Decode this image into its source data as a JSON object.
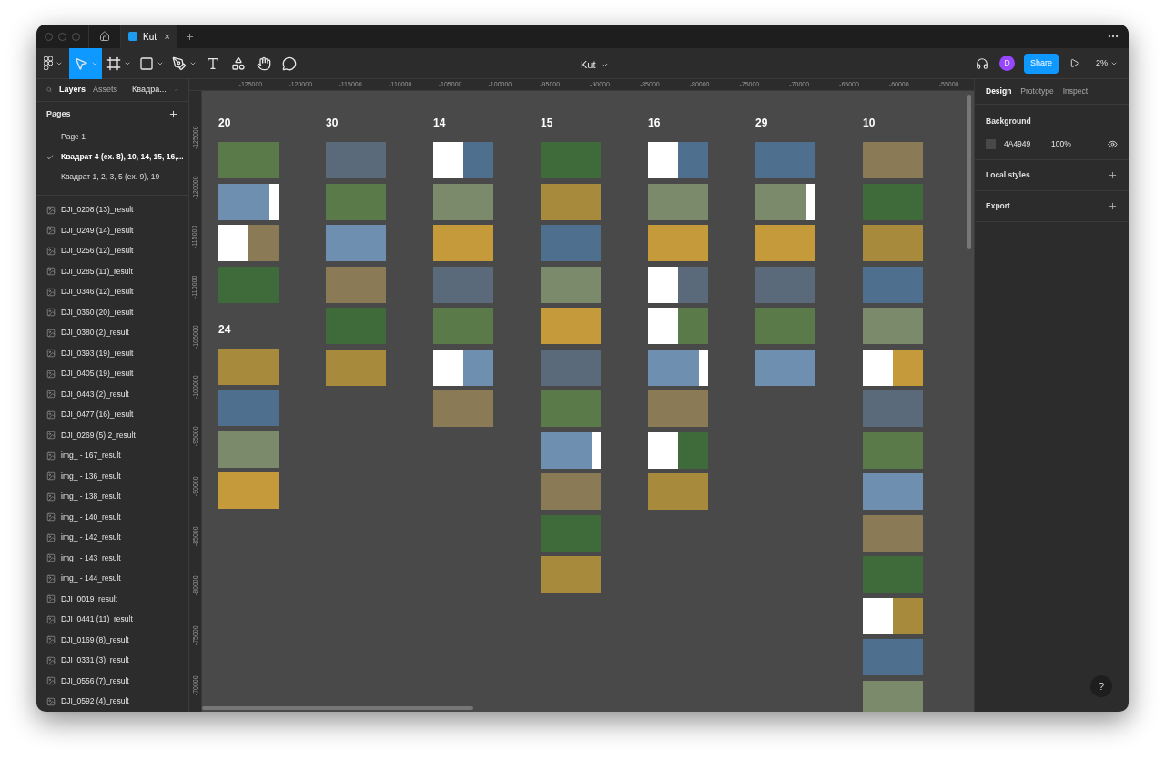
{
  "tab": {
    "title": "Kut",
    "close": "×"
  },
  "toolbar": {
    "tools": [
      {
        "kind": "main-menu",
        "selected": false
      },
      {
        "kind": "move",
        "selected": true
      },
      {
        "kind": "frame",
        "selected": false
      },
      {
        "kind": "shape",
        "selected": false
      },
      {
        "kind": "pen",
        "selected": false
      },
      {
        "kind": "text",
        "selected": false
      },
      {
        "kind": "resources",
        "selected": false
      },
      {
        "kind": "hand",
        "selected": false
      },
      {
        "kind": "comment",
        "selected": false
      }
    ],
    "file_name": "Kut",
    "avatar": "D",
    "share": "Share",
    "zoom": "2%"
  },
  "left_panel": {
    "tabs": [
      {
        "label": "Layers",
        "selected": true
      },
      {
        "label": "Assets",
        "selected": false
      }
    ],
    "page_switch": "Квадра...",
    "pages_title": "Pages",
    "pages": [
      {
        "label": "Page 1",
        "selected": false
      },
      {
        "label": "Квадрат 4 (ex. 8), 10, 14, 15, 16,...",
        "selected": true
      },
      {
        "label": "Квадрат 1, 2, 3, 5 (ex. 9), 19",
        "selected": false
      }
    ],
    "layers": [
      "DJI_0208 (13)_result",
      "DJI_0249 (14)_result",
      "DJI_0256 (12)_result",
      "DJI_0285 (11)_result",
      "DJI_0346 (12)_result",
      "DJI_0360 (20)_result",
      "DJI_0380 (2)_result",
      "DJI_0393 (19)_result",
      "DJI_0405 (19)_result",
      "DJI_0443 (2)_result",
      "DJI_0477 (16)_result",
      "DJI_0269 (5) 2_result",
      "img_ - 167_result",
      "img_ - 136_result",
      "img_ - 138_result",
      "img_ - 140_result",
      "img_ - 142_result",
      "img_ - 143_result",
      "img_ - 144_result",
      "DJI_0019_result",
      "DJI_0441 (11)_result",
      "DJI_0169 (8)_result",
      "DJI_0331 (3)_result",
      "DJI_0556 (7)_result",
      "DJI_0592 (4)_result"
    ]
  },
  "rulers": {
    "horizontal": [
      "-125000",
      "-120000",
      "-115000",
      "-110000",
      "-105000",
      "-100000",
      "-95000",
      "-90000",
      "-85000",
      "-80000",
      "-75000",
      "-70000",
      "-65000",
      "-60000",
      "-55000"
    ],
    "vertical": [
      "-125000",
      "-120000",
      "-115000",
      "-110000",
      "-105000",
      "-100000",
      "-95000",
      "-90000",
      "-85000",
      "-80000",
      "-75000",
      "-70000"
    ]
  },
  "canvas": {
    "columns": [
      [
        {
          "title": "20",
          "frames": [
            {
              "kind": "photo"
            },
            {
              "kind": "white-right"
            },
            {
              "kind": "white-left"
            },
            {
              "kind": "photo"
            }
          ]
        },
        {
          "title": "24",
          "frames": [
            {
              "kind": "photo"
            },
            {
              "kind": "photo"
            },
            {
              "kind": "photo"
            },
            {
              "kind": "photo"
            }
          ]
        }
      ],
      [
        {
          "title": "30",
          "frames": [
            {
              "kind": "photo"
            },
            {
              "kind": "photo"
            },
            {
              "kind": "photo"
            },
            {
              "kind": "photo"
            },
            {
              "kind": "photo"
            },
            {
              "kind": "photo"
            }
          ]
        }
      ],
      [
        {
          "title": "14",
          "frames": [
            {
              "kind": "white-left"
            },
            {
              "kind": "photo"
            },
            {
              "kind": "photo"
            },
            {
              "kind": "photo"
            },
            {
              "kind": "photo"
            },
            {
              "kind": "white-left"
            },
            {
              "kind": "photo"
            }
          ]
        }
      ],
      [
        {
          "title": "15",
          "frames": [
            {
              "kind": "photo"
            },
            {
              "kind": "photo"
            },
            {
              "kind": "photo"
            },
            {
              "kind": "photo"
            },
            {
              "kind": "photo"
            },
            {
              "kind": "photo"
            },
            {
              "kind": "photo"
            },
            {
              "kind": "white-right"
            },
            {
              "kind": "photo"
            },
            {
              "kind": "photo"
            },
            {
              "kind": "photo"
            }
          ]
        }
      ],
      [
        {
          "title": "16",
          "frames": [
            {
              "kind": "white-left"
            },
            {
              "kind": "photo"
            },
            {
              "kind": "photo"
            },
            {
              "kind": "white-left"
            },
            {
              "kind": "white-left"
            },
            {
              "kind": "white-right"
            },
            {
              "kind": "photo"
            },
            {
              "kind": "white-left"
            },
            {
              "kind": "photo"
            }
          ]
        }
      ],
      [
        {
          "title": "29",
          "frames": [
            {
              "kind": "photo"
            },
            {
              "kind": "white-right"
            },
            {
              "kind": "photo"
            },
            {
              "kind": "photo"
            },
            {
              "kind": "photo"
            },
            {
              "kind": "photo"
            }
          ]
        }
      ],
      [
        {
          "title": "10",
          "frames": [
            {
              "kind": "photo"
            },
            {
              "kind": "photo"
            },
            {
              "kind": "photo"
            },
            {
              "kind": "photo"
            },
            {
              "kind": "photo"
            },
            {
              "kind": "white-left"
            },
            {
              "kind": "photo"
            },
            {
              "kind": "photo"
            },
            {
              "kind": "photo"
            },
            {
              "kind": "photo"
            },
            {
              "kind": "photo"
            },
            {
              "kind": "white-left"
            },
            {
              "kind": "photo"
            },
            {
              "kind": "photo"
            }
          ]
        }
      ]
    ],
    "help": "?"
  },
  "right_panel": {
    "tabs": [
      {
        "label": "Design",
        "selected": true
      },
      {
        "label": "Prototype",
        "selected": false
      },
      {
        "label": "Inspect",
        "selected": false
      }
    ],
    "background_title": "Background",
    "background_color": "4A4949",
    "background_opacity": "100%",
    "sections": [
      "Local styles",
      "Export"
    ]
  }
}
